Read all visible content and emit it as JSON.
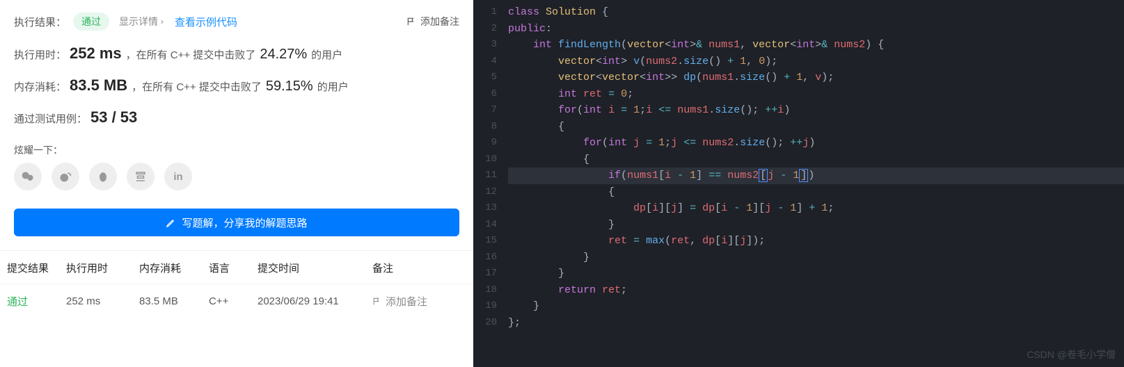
{
  "header": {
    "result_label": "执行结果：",
    "pass_text": "通过",
    "details_text": "显示详情",
    "example_link": "查看示例代码",
    "add_note": "添加备注"
  },
  "runtime": {
    "label": "执行用时：",
    "value": "252 ms",
    "mid": "，在所有 C++ 提交中击败了",
    "pct": "24.27%",
    "suffix": "的用户"
  },
  "memory": {
    "label": "内存消耗：",
    "value": "83.5 MB",
    "mid": "，在所有 C++ 提交中击败了",
    "pct": "59.15%",
    "suffix": "的用户"
  },
  "testcases": {
    "label": "通过测试用例：",
    "value": "53 / 53"
  },
  "share": {
    "label": "炫耀一下："
  },
  "share_icons": [
    "wechat-icon",
    "weibo-icon",
    "qq-icon",
    "douban-icon",
    "linkedin-icon"
  ],
  "write_btn": "写题解，分享我的解题思路",
  "table": {
    "head": {
      "result": "提交结果",
      "time": "执行用时",
      "mem": "内存消耗",
      "lang": "语言",
      "submitted": "提交时间",
      "note": "备注"
    },
    "row": {
      "result": "通过",
      "time": "252 ms",
      "mem": "83.5 MB",
      "lang": "C++",
      "submitted": "2023/06/29 19:41",
      "add_note": "添加备注"
    }
  },
  "code": {
    "lines": [
      [
        [
          "kw",
          "class "
        ],
        [
          "cls",
          "Solution"
        ],
        [
          "pn",
          " {"
        ]
      ],
      [
        [
          "kw",
          "public"
        ],
        [
          "pn",
          ":"
        ]
      ],
      [
        [
          "pn",
          "    "
        ],
        [
          "type",
          "int "
        ],
        [
          "fn",
          "findLength"
        ],
        [
          "pn",
          "("
        ],
        [
          "cls",
          "vector"
        ],
        [
          "pn",
          "<"
        ],
        [
          "type",
          "int"
        ],
        [
          "pn",
          ">"
        ],
        [
          "op",
          "& "
        ],
        [
          "var",
          "nums1"
        ],
        [
          "pn",
          ", "
        ],
        [
          "cls",
          "vector"
        ],
        [
          "pn",
          "<"
        ],
        [
          "type",
          "int"
        ],
        [
          "pn",
          ">"
        ],
        [
          "op",
          "& "
        ],
        [
          "var",
          "nums2"
        ],
        [
          "pn",
          ") {"
        ]
      ],
      [
        [
          "pn",
          "        "
        ],
        [
          "cls",
          "vector"
        ],
        [
          "pn",
          "<"
        ],
        [
          "type",
          "int"
        ],
        [
          "pn",
          "> "
        ],
        [
          "fn",
          "v"
        ],
        [
          "pn",
          "("
        ],
        [
          "var",
          "nums2"
        ],
        [
          "pn",
          "."
        ],
        [
          "fn",
          "size"
        ],
        [
          "pn",
          "() "
        ],
        [
          "op",
          "+"
        ],
        [
          "pn",
          " "
        ],
        [
          "num",
          "1"
        ],
        [
          "pn",
          ", "
        ],
        [
          "num",
          "0"
        ],
        [
          "pn",
          ");"
        ]
      ],
      [
        [
          "pn",
          "        "
        ],
        [
          "cls",
          "vector"
        ],
        [
          "pn",
          "<"
        ],
        [
          "cls",
          "vector"
        ],
        [
          "pn",
          "<"
        ],
        [
          "type",
          "int"
        ],
        [
          "pn",
          ">> "
        ],
        [
          "fn",
          "dp"
        ],
        [
          "pn",
          "("
        ],
        [
          "var",
          "nums1"
        ],
        [
          "pn",
          "."
        ],
        [
          "fn",
          "size"
        ],
        [
          "pn",
          "() "
        ],
        [
          "op",
          "+"
        ],
        [
          "pn",
          " "
        ],
        [
          "num",
          "1"
        ],
        [
          "pn",
          ", "
        ],
        [
          "var",
          "v"
        ],
        [
          "pn",
          ");"
        ]
      ],
      [
        [
          "pn",
          "        "
        ],
        [
          "type",
          "int "
        ],
        [
          "var",
          "ret"
        ],
        [
          "pn",
          " "
        ],
        [
          "op",
          "="
        ],
        [
          "pn",
          " "
        ],
        [
          "num",
          "0"
        ],
        [
          "pn",
          ";"
        ]
      ],
      [
        [
          "pn",
          "        "
        ],
        [
          "kw",
          "for"
        ],
        [
          "pn",
          "("
        ],
        [
          "type",
          "int "
        ],
        [
          "var",
          "i"
        ],
        [
          "pn",
          " "
        ],
        [
          "op",
          "="
        ],
        [
          "pn",
          " "
        ],
        [
          "num",
          "1"
        ],
        [
          "pn",
          ";"
        ],
        [
          "var",
          "i"
        ],
        [
          "pn",
          " "
        ],
        [
          "op",
          "<="
        ],
        [
          "pn",
          " "
        ],
        [
          "var",
          "nums1"
        ],
        [
          "pn",
          "."
        ],
        [
          "fn",
          "size"
        ],
        [
          "pn",
          "(); "
        ],
        [
          "op",
          "++"
        ],
        [
          "var",
          "i"
        ],
        [
          "pn",
          ")"
        ]
      ],
      [
        [
          "pn",
          "        {"
        ]
      ],
      [
        [
          "pn",
          "            "
        ],
        [
          "kw",
          "for"
        ],
        [
          "pn",
          "("
        ],
        [
          "type",
          "int "
        ],
        [
          "var",
          "j"
        ],
        [
          "pn",
          " "
        ],
        [
          "op",
          "="
        ],
        [
          "pn",
          " "
        ],
        [
          "num",
          "1"
        ],
        [
          "pn",
          ";"
        ],
        [
          "var",
          "j"
        ],
        [
          "pn",
          " "
        ],
        [
          "op",
          "<="
        ],
        [
          "pn",
          " "
        ],
        [
          "var",
          "nums2"
        ],
        [
          "pn",
          "."
        ],
        [
          "fn",
          "size"
        ],
        [
          "pn",
          "(); "
        ],
        [
          "op",
          "++"
        ],
        [
          "var",
          "j"
        ],
        [
          "pn",
          ")"
        ]
      ],
      [
        [
          "pn",
          "            {"
        ]
      ],
      [
        [
          "pn",
          "                "
        ],
        [
          "kw",
          "if"
        ],
        [
          "pn",
          "("
        ],
        [
          "var",
          "nums1"
        ],
        [
          "pn",
          "["
        ],
        [
          "var",
          "i"
        ],
        [
          "pn",
          " "
        ],
        [
          "op",
          "-"
        ],
        [
          "pn",
          " "
        ],
        [
          "num",
          "1"
        ],
        [
          "pn",
          "] "
        ],
        [
          "op",
          "=="
        ],
        [
          "pn",
          " "
        ],
        [
          "var",
          "nums2"
        ],
        [
          "box",
          "["
        ],
        [
          "var",
          "j"
        ],
        [
          "pn",
          " "
        ],
        [
          "op",
          "-"
        ],
        [
          "pn",
          " "
        ],
        [
          "num",
          "1"
        ],
        [
          "box",
          "]"
        ],
        [
          "pn",
          ")"
        ]
      ],
      [
        [
          "pn",
          "                {"
        ]
      ],
      [
        [
          "pn",
          "                    "
        ],
        [
          "var",
          "dp"
        ],
        [
          "pn",
          "["
        ],
        [
          "var",
          "i"
        ],
        [
          "pn",
          "]["
        ],
        [
          "var",
          "j"
        ],
        [
          "pn",
          "] "
        ],
        [
          "op",
          "="
        ],
        [
          "pn",
          " "
        ],
        [
          "var",
          "dp"
        ],
        [
          "pn",
          "["
        ],
        [
          "var",
          "i"
        ],
        [
          "pn",
          " "
        ],
        [
          "op",
          "-"
        ],
        [
          "pn",
          " "
        ],
        [
          "num",
          "1"
        ],
        [
          "pn",
          "]["
        ],
        [
          "var",
          "j"
        ],
        [
          "pn",
          " "
        ],
        [
          "op",
          "-"
        ],
        [
          "pn",
          " "
        ],
        [
          "num",
          "1"
        ],
        [
          "pn",
          "] "
        ],
        [
          "op",
          "+"
        ],
        [
          "pn",
          " "
        ],
        [
          "num",
          "1"
        ],
        [
          "pn",
          ";"
        ]
      ],
      [
        [
          "pn",
          "                }"
        ]
      ],
      [
        [
          "pn",
          "                "
        ],
        [
          "var",
          "ret"
        ],
        [
          "pn",
          " "
        ],
        [
          "op",
          "="
        ],
        [
          "pn",
          " "
        ],
        [
          "fn",
          "max"
        ],
        [
          "pn",
          "("
        ],
        [
          "var",
          "ret"
        ],
        [
          "pn",
          ", "
        ],
        [
          "var",
          "dp"
        ],
        [
          "pn",
          "["
        ],
        [
          "var",
          "i"
        ],
        [
          "pn",
          "]["
        ],
        [
          "var",
          "j"
        ],
        [
          "pn",
          "]);"
        ]
      ],
      [
        [
          "pn",
          "            }"
        ]
      ],
      [
        [
          "pn",
          "        }"
        ]
      ],
      [
        [
          "pn",
          "        "
        ],
        [
          "kw",
          "return "
        ],
        [
          "var",
          "ret"
        ],
        [
          "pn",
          ";"
        ]
      ],
      [
        [
          "pn",
          "    }"
        ]
      ],
      [
        [
          "pn",
          "};"
        ]
      ]
    ],
    "highlight_line": 11
  },
  "watermark": "CSDN @卷毛小学僧"
}
